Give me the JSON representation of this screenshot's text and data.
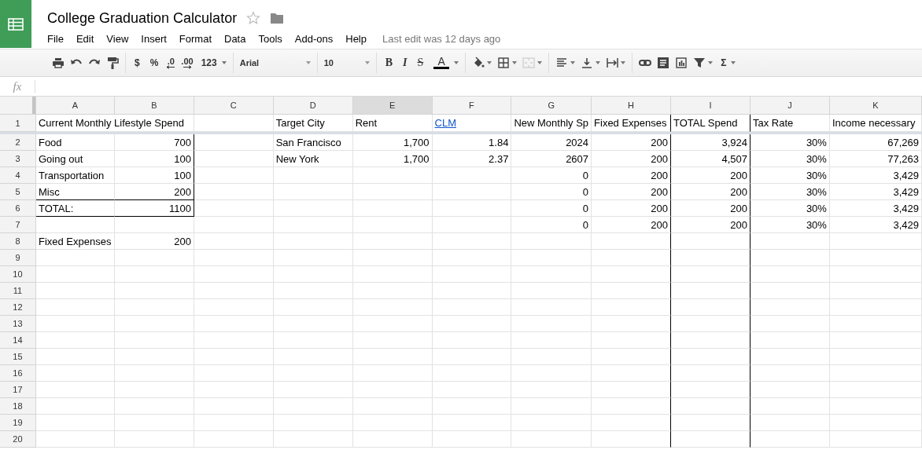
{
  "doc": {
    "title": "College Graduation Calculator",
    "starred": false
  },
  "menu": [
    "File",
    "Edit",
    "View",
    "Insert",
    "Format",
    "Data",
    "Tools",
    "Add-ons",
    "Help"
  ],
  "last_edit": "Last edit was 12 days ago",
  "toolbar": [
    [
      {
        "kind": "print"
      },
      {
        "kind": "undo"
      },
      {
        "kind": "redo"
      },
      {
        "kind": "paint"
      }
    ],
    [
      {
        "kind": "text",
        "label": "$"
      },
      {
        "kind": "text",
        "label": "%"
      },
      {
        "kind": "decless",
        "label": ".0"
      },
      {
        "kind": "decmore",
        "label": ".00"
      },
      {
        "kind": "text",
        "label": "123",
        "menu": true
      }
    ],
    [
      {
        "kind": "font",
        "value": "Arial"
      }
    ],
    [
      {
        "kind": "fontsize",
        "value": "10"
      }
    ],
    [
      {
        "kind": "bold",
        "label": "B"
      },
      {
        "kind": "italic",
        "label": "I"
      },
      {
        "kind": "strike",
        "label": "S"
      },
      {
        "kind": "textcolor",
        "label": "A",
        "menu": true
      }
    ],
    [
      {
        "kind": "fill",
        "menu": true
      },
      {
        "kind": "borders",
        "menu": true
      },
      {
        "kind": "merge",
        "menu": true,
        "disabled": true
      }
    ],
    [
      {
        "kind": "align",
        "menu": true
      },
      {
        "kind": "valign",
        "menu": true
      },
      {
        "kind": "wrap",
        "menu": true
      }
    ],
    [
      {
        "kind": "link"
      },
      {
        "kind": "comment"
      },
      {
        "kind": "chart"
      },
      {
        "kind": "filter",
        "menu": true
      },
      {
        "kind": "text",
        "label": "Σ",
        "menu": true
      }
    ]
  ],
  "formula_bar": {
    "label": "fx"
  },
  "columns": [
    {
      "letter": "A",
      "selected": false,
      "border_right": false
    },
    {
      "letter": "B",
      "selected": false,
      "border_right": false
    },
    {
      "letter": "C",
      "selected": false,
      "border_right": false
    },
    {
      "letter": "D",
      "selected": false,
      "border_right": false
    },
    {
      "letter": "E",
      "selected": true,
      "border_right": false
    },
    {
      "letter": "F",
      "selected": false,
      "border_right": false
    },
    {
      "letter": "G",
      "selected": false,
      "border_right": false
    },
    {
      "letter": "H",
      "selected": false,
      "border_right": true
    },
    {
      "letter": "I",
      "selected": false,
      "border_right": true
    },
    {
      "letter": "J",
      "selected": false,
      "border_right": false
    },
    {
      "letter": "K",
      "selected": false,
      "border_right": false
    }
  ],
  "rows": [
    {
      "number": "1",
      "cells": {
        "A": {
          "text": "Current Monthly Lifestyle Spend",
          "kind": "text"
        },
        "D": {
          "text": "Target City",
          "kind": "text"
        },
        "E": {
          "text": "Rent",
          "kind": "text"
        },
        "F": {
          "text": "CLM",
          "kind": "link"
        },
        "G": {
          "text": "New Monthly Sp",
          "kind": "text"
        },
        "H": {
          "text": "Fixed Expenses",
          "kind": "text"
        },
        "I": {
          "text": "TOTAL Spend",
          "kind": "text"
        },
        "J": {
          "text": "Tax Rate",
          "kind": "text"
        },
        "K": {
          "text": "Income necessary",
          "kind": "text"
        }
      }
    },
    {
      "number": "2",
      "cells": {
        "A": {
          "text": "Food",
          "kind": "text"
        },
        "B": {
          "text": "700",
          "kind": "number",
          "border_right": true
        },
        "D": {
          "text": "San Francisco",
          "kind": "text"
        },
        "E": {
          "text": "1,700",
          "kind": "number"
        },
        "F": {
          "text": "1.84",
          "kind": "number"
        },
        "G": {
          "text": "2024",
          "kind": "number"
        },
        "H": {
          "text": "200",
          "kind": "number"
        },
        "I": {
          "text": "3,924",
          "kind": "number"
        },
        "J": {
          "text": "30%",
          "kind": "number"
        },
        "K": {
          "text": "67,269",
          "kind": "number"
        }
      }
    },
    {
      "number": "3",
      "cells": {
        "A": {
          "text": "Going out",
          "kind": "text"
        },
        "B": {
          "text": "100",
          "kind": "number",
          "border_right": true
        },
        "D": {
          "text": "New York",
          "kind": "text"
        },
        "E": {
          "text": "1,700",
          "kind": "number"
        },
        "F": {
          "text": "2.37",
          "kind": "number"
        },
        "G": {
          "text": "2607",
          "kind": "number"
        },
        "H": {
          "text": "200",
          "kind": "number"
        },
        "I": {
          "text": "4,507",
          "kind": "number"
        },
        "J": {
          "text": "30%",
          "kind": "number"
        },
        "K": {
          "text": "77,263",
          "kind": "number"
        }
      }
    },
    {
      "number": "4",
      "cells": {
        "A": {
          "text": "Transportation",
          "kind": "text"
        },
        "B": {
          "text": "100",
          "kind": "number",
          "border_right": true
        },
        "G": {
          "text": "0",
          "kind": "number"
        },
        "H": {
          "text": "200",
          "kind": "number"
        },
        "I": {
          "text": "200",
          "kind": "number"
        },
        "J": {
          "text": "30%",
          "kind": "number"
        },
        "K": {
          "text": "3,429",
          "kind": "number"
        }
      }
    },
    {
      "number": "5",
      "cells": {
        "A": {
          "text": "Misc",
          "kind": "text",
          "border_bottom": true
        },
        "B": {
          "text": "200",
          "kind": "number",
          "border_right": true,
          "border_bottom": true
        },
        "G": {
          "text": "0",
          "kind": "number"
        },
        "H": {
          "text": "200",
          "kind": "number"
        },
        "I": {
          "text": "200",
          "kind": "number"
        },
        "J": {
          "text": "30%",
          "kind": "number"
        },
        "K": {
          "text": "3,429",
          "kind": "number"
        }
      }
    },
    {
      "number": "6",
      "cells": {
        "A": {
          "text": "TOTAL:",
          "kind": "text",
          "border_bottom": true
        },
        "B": {
          "text": "1100",
          "kind": "number",
          "border_right": true,
          "border_bottom": true
        },
        "G": {
          "text": "0",
          "kind": "number"
        },
        "H": {
          "text": "200",
          "kind": "number"
        },
        "I": {
          "text": "200",
          "kind": "number"
        },
        "J": {
          "text": "30%",
          "kind": "number"
        },
        "K": {
          "text": "3,429",
          "kind": "number"
        }
      }
    },
    {
      "number": "7",
      "cells": {
        "G": {
          "text": "0",
          "kind": "number"
        },
        "H": {
          "text": "200",
          "kind": "number"
        },
        "I": {
          "text": "200",
          "kind": "number"
        },
        "J": {
          "text": "30%",
          "kind": "number"
        },
        "K": {
          "text": "3,429",
          "kind": "number"
        }
      }
    },
    {
      "number": "8",
      "cells": {
        "A": {
          "text": "Fixed Expenses",
          "kind": "text"
        },
        "B": {
          "text": "200",
          "kind": "number"
        }
      }
    },
    {
      "number": "9"
    },
    {
      "number": "10"
    },
    {
      "number": "11"
    },
    {
      "number": "12"
    },
    {
      "number": "13"
    },
    {
      "number": "14"
    },
    {
      "number": "15"
    },
    {
      "number": "16"
    },
    {
      "number": "17"
    },
    {
      "number": "18"
    },
    {
      "number": "19"
    },
    {
      "number": "20"
    }
  ]
}
